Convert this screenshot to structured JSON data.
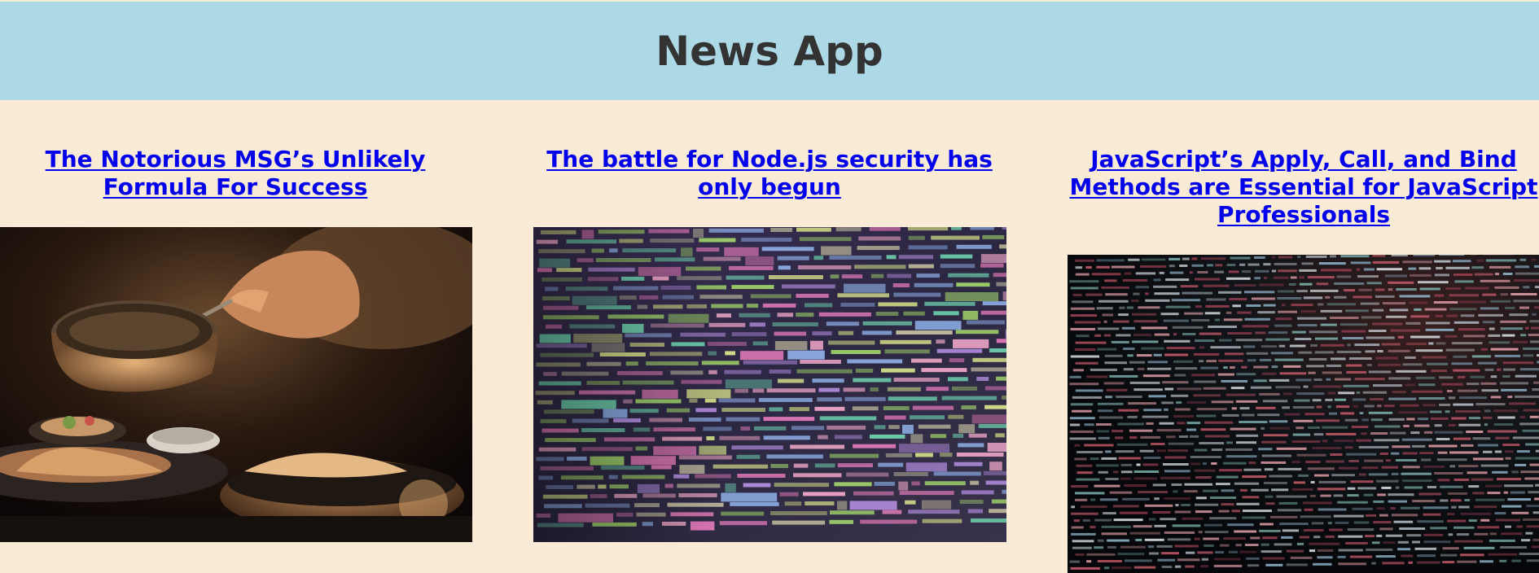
{
  "header": {
    "title": "News App"
  },
  "articles": [
    {
      "title": "The Notorious MSG’s Unlikely Formula For Success",
      "image_subject": "food-serving-photo"
    },
    {
      "title": "The battle for Node.js security has only begun",
      "image_subject": "colorful-code-screen-photo"
    },
    {
      "title": "JavaScript’s Apply, Call, and Bind Methods are Essential for JavaScript Professionals",
      "image_subject": "dark-code-screen-photo"
    }
  ],
  "colors": {
    "page_background": "#faebd7",
    "header_background": "#add8e6",
    "header_text": "#333333",
    "link": "#0000ee"
  }
}
